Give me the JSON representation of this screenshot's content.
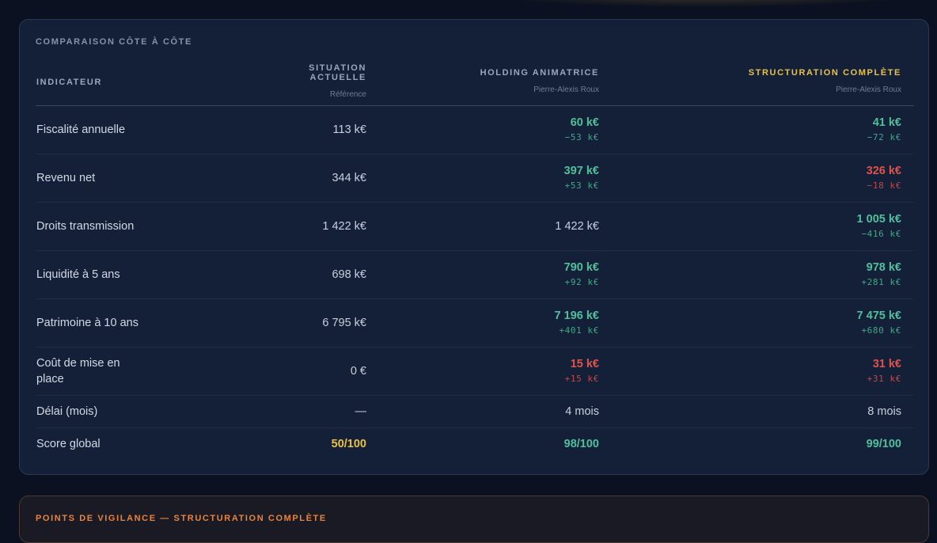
{
  "comparison": {
    "title": "COMPARAISON CÔTE À CÔTE",
    "header": {
      "indicator_label": "INDICATEUR",
      "columns": [
        {
          "label": "SITUATION ACTUELLE",
          "sub": "Référence",
          "highlight": false
        },
        {
          "label": "HOLDING ANIMATRICE",
          "sub": "Pierre-Alexis Roux",
          "highlight": false
        },
        {
          "label": "STRUCTURATION COMPLÈTE",
          "sub": "Pierre-Alexis Roux",
          "highlight": true
        }
      ]
    },
    "rows": [
      {
        "label": "Fiscalité annuelle",
        "current": "113 k€",
        "holding": {
          "value": "60 k€",
          "delta": "−53 k€",
          "tone": "green"
        },
        "complete": {
          "value": "41 k€",
          "delta": "−72 k€",
          "tone": "green"
        }
      },
      {
        "label": "Revenu net",
        "current": "344 k€",
        "holding": {
          "value": "397 k€",
          "delta": "+53 k€",
          "tone": "green"
        },
        "complete": {
          "value": "326 k€",
          "delta": "−18 k€",
          "tone": "red"
        }
      },
      {
        "label": "Droits transmission",
        "current": "1 422 k€",
        "holding": {
          "value": "1 422 k€",
          "delta": "",
          "tone": "plain"
        },
        "complete": {
          "value": "1 005 k€",
          "delta": "−416 k€",
          "tone": "green"
        }
      },
      {
        "label": "Liquidité à 5 ans",
        "current": "698 k€",
        "holding": {
          "value": "790 k€",
          "delta": "+92 k€",
          "tone": "green"
        },
        "complete": {
          "value": "978 k€",
          "delta": "+281 k€",
          "tone": "green"
        }
      },
      {
        "label": "Patrimoine à 10 ans",
        "current": "6 795 k€",
        "holding": {
          "value": "7 196 k€",
          "delta": "+401 k€",
          "tone": "green"
        },
        "complete": {
          "value": "7 475 k€",
          "delta": "+680 k€",
          "tone": "green"
        }
      },
      {
        "label": "Coût de mise en place",
        "current": "0 €",
        "holding": {
          "value": "15 k€",
          "delta": "+15 k€",
          "tone": "red"
        },
        "complete": {
          "value": "31 k€",
          "delta": "+31 k€",
          "tone": "red"
        }
      },
      {
        "label": "Délai (mois)",
        "current": "—",
        "holding": {
          "value": "4 mois",
          "delta": "",
          "tone": "plain"
        },
        "complete": {
          "value": "8 mois",
          "delta": "",
          "tone": "plain"
        }
      },
      {
        "label": "Score global",
        "current": "50/100",
        "holding": {
          "value": "98/100",
          "delta": "",
          "tone": "score-green"
        },
        "complete": {
          "value": "99/100",
          "delta": "",
          "tone": "score-green"
        }
      }
    ],
    "current_score_tone": "gold"
  },
  "vigilance": {
    "title": "POINTS DE VIGILANCE — STRUCTURATION COMPLÈTE"
  },
  "colors": {
    "background": "#0b1120",
    "card": "#142038",
    "green": "#4fbf9c",
    "red": "#e0524c",
    "gold": "#e8c14a",
    "orange": "#e8843c"
  }
}
